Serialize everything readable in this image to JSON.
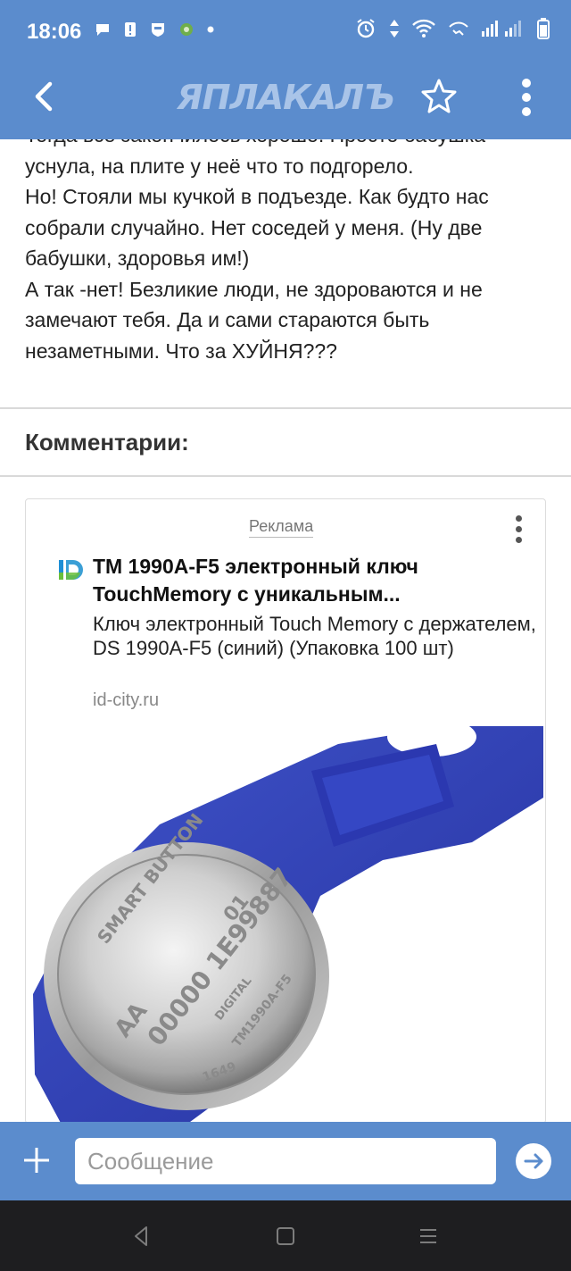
{
  "status_bar": {
    "time": "18:06"
  },
  "app_bar": {
    "brand": "ЯПЛАКАЛЪ"
  },
  "post": {
    "lines": [
      "Тогда все закончилось хорошо. Просто бабушка уснула, на плите у неё что то подгорело.",
      "Но! Стояли мы кучкой в подъезде. Как будто нас собрали случайно. Нет соседей у меня. (Ну две бабушки, здоровья им!)",
      "А так -нет! Безликие люди, не здороваются и не замечают тебя. Да и сами стараются быть незаметными. Что за ХУЙНЯ???"
    ]
  },
  "comments": {
    "title": "Комментарии:"
  },
  "ad": {
    "label": "Реклама",
    "title": "ТМ 1990A-F5 электронный ключ TouchMemory с уникальным...",
    "description": "Ключ электронный Touch Memory с держателем, DS 1990A-F5 (синий) (Упаковка 100 шт)",
    "domain": "id-city.ru",
    "image_text": {
      "brand": "SMART BUTTON",
      "code": "00000 1E99887",
      "aa": "AA",
      "num": "01",
      "digital": "DIGITAL",
      "model": "TM1990A-F5",
      "lot": "1649"
    }
  },
  "composer": {
    "placeholder": "Сообщение"
  },
  "colors": {
    "primary": "#5b8ccd",
    "navbar": "#1e1e20",
    "key_blue": "#3444b8"
  }
}
